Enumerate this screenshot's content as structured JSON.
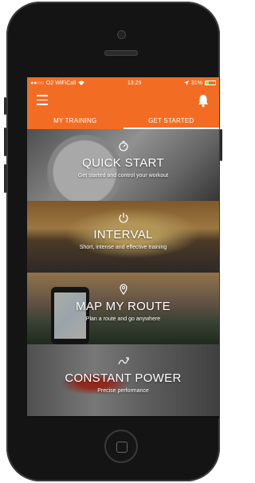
{
  "status": {
    "carrier": "O2 WiFiCall",
    "time": "13:29",
    "battery": "31%",
    "battery_level": 0.31
  },
  "tabs": [
    {
      "label": "MY TRAINING",
      "active": false
    },
    {
      "label": "GET STARTED",
      "active": true
    }
  ],
  "cards": [
    {
      "title": "QUICK START",
      "subtitle": "Get started and control your workout",
      "icon": "stopwatch-icon"
    },
    {
      "title": "INTERVAL",
      "subtitle": "Short, intense and effective training",
      "icon": "power-icon"
    },
    {
      "title": "MAP MY ROUTE",
      "subtitle": "Plan a route and go anywhere",
      "icon": "location-pin-icon"
    },
    {
      "title": "CONSTANT POWER",
      "subtitle": "Precise performance",
      "icon": "power-curve-icon"
    }
  ],
  "colors": {
    "accent": "#f26d23",
    "battery_fill": "#8cf06a"
  }
}
